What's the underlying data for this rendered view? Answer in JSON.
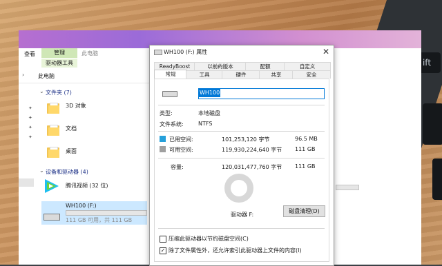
{
  "ribbon": {
    "tab_view": "查看",
    "tab_manage": "管理",
    "tab_this_pc": "此电脑",
    "tab_drive_tools": "驱动器工具"
  },
  "addressbar": {
    "path": "此电脑"
  },
  "explorer": {
    "folders_header": "文件夹 (7)",
    "folders": [
      {
        "label": "3D 对象"
      },
      {
        "label": "文档"
      },
      {
        "label": "桌面"
      }
    ],
    "devices_header": "设备和驱动器 (4)",
    "device_video": "腾讯视频 (32 位)",
    "drive_name": "WH100 (F:)",
    "drive_capacity": "111 GB 可用，共 111 GB",
    "drive_fill_fraction": 0.0
  },
  "dialog": {
    "title": "WH100 (F:) 属性",
    "tabs_row1": [
      "ReadyBoost",
      "以前的版本",
      "配额",
      "自定义"
    ],
    "tabs_row2": [
      "常规",
      "工具",
      "硬件",
      "共享",
      "安全"
    ],
    "active_tab": "常规",
    "volume_name": "WH100",
    "type_label": "类型:",
    "type_value": "本地磁盘",
    "fs_label": "文件系统:",
    "fs_value": "NTFS",
    "used_label": "已用空间:",
    "used_bytes": "101,253,120 字节",
    "used_size": "96.5 MB",
    "free_label": "可用空间:",
    "free_bytes": "119,930,224,640 字节",
    "free_size": "111 GB",
    "capacity_label": "容量:",
    "capacity_bytes": "120,031,477,760 字节",
    "capacity_size": "111 GB",
    "drive_label": "驱动器 F:",
    "cleanup_button": "磁盘清理(D)",
    "compress_label": "压缩此驱动器以节约磁盘空间(C)",
    "compress_checked": false,
    "index_label": "除了文件属性外，还允许索引此驱动器上文件的内容(I)",
    "index_checked": true,
    "colors": {
      "used": "#26a0da",
      "free": "#a0a0a0"
    }
  },
  "laptop_keys": {
    "shift_key": "ift"
  }
}
